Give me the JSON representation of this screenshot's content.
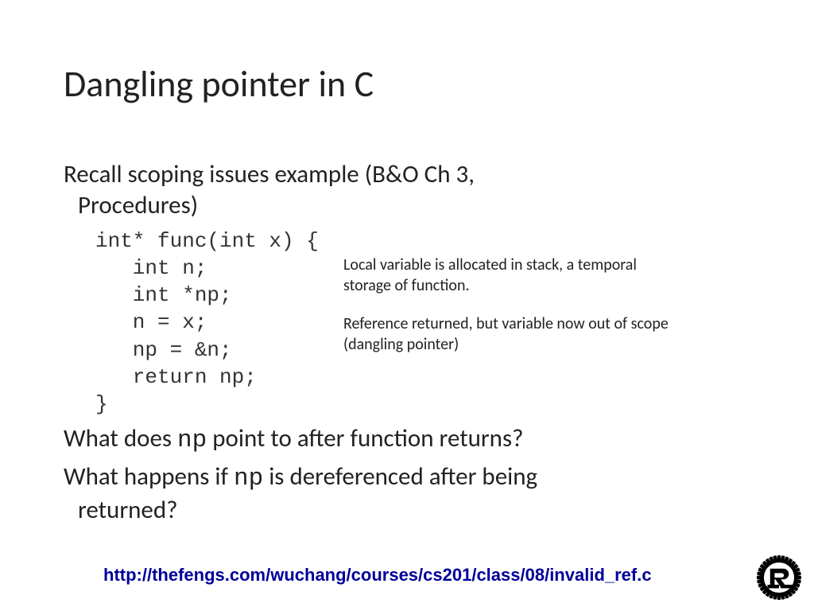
{
  "title": "Dangling pointer in C",
  "intro_l1": "Recall scoping issues example (B&O Ch 3,",
  "intro_l2": "Procedures)",
  "code": "int* func(int x) {\n   int n;\n   int *np;\n   n = x;\n   np = &n;\n   return np;\n}",
  "note1": "Local variable is allocated in stack, a temporal storage of function.",
  "note2": "Reference returned, but variable now out of scope (dangling pointer)",
  "q1_a": "What does ",
  "q1_code": "np",
  "q1_b": "  point to after function returns?",
  "q2_a": "What happens if ",
  "q2_code": "np",
  "q2_b": " is dereferenced after being",
  "q2_c": "returned?",
  "link": "http://thefengs.com/wuchang/courses/cs201/class/08/invalid_ref.c"
}
